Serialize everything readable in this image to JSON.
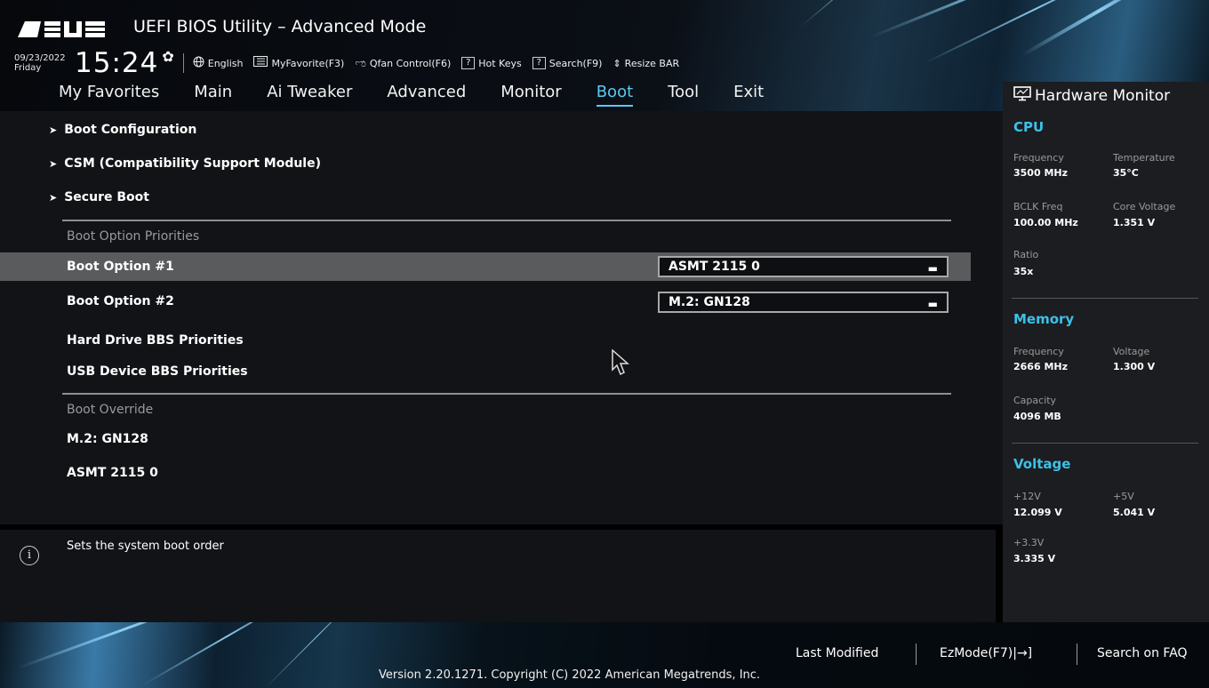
{
  "header": {
    "brand": "ASUS",
    "title": "UEFI BIOS Utility – Advanced Mode",
    "date": "09/23/2022",
    "day": "Friday",
    "time": "15:24",
    "items": [
      {
        "icon": "globe-icon",
        "label": "English"
      },
      {
        "icon": "favorite-icon",
        "label": "MyFavorite(F3)"
      },
      {
        "icon": "fan-icon",
        "label": "Qfan Control(F6)"
      },
      {
        "icon": "help-box-icon",
        "label": "Hot Keys"
      },
      {
        "icon": "help-box-icon",
        "label": "Search(F9)"
      },
      {
        "icon": "resize-bar-icon",
        "label": "Resize BAR"
      }
    ]
  },
  "nav": {
    "tabs": [
      "My Favorites",
      "Main",
      "Ai Tweaker",
      "Advanced",
      "Monitor",
      "Boot",
      "Tool",
      "Exit"
    ],
    "active": "Boot"
  },
  "main": {
    "submenus": [
      "Boot Configuration",
      "CSM (Compatibility Support Module)",
      "Secure Boot"
    ],
    "priorities_label": "Boot Option Priorities",
    "boot_option_1": {
      "label": "Boot Option #1",
      "value": "ASMT 2115 0"
    },
    "boot_option_2": {
      "label": "Boot Option #2",
      "value": "M.2: GN128"
    },
    "bbs": [
      "Hard Drive BBS Priorities",
      "USB Device BBS Priorities"
    ],
    "override_label": "Boot Override",
    "override_items": [
      "M.2: GN128",
      "ASMT 2115 0"
    ]
  },
  "help": {
    "text": "Sets the system boot order"
  },
  "hw_monitor": {
    "title": "Hardware Monitor",
    "cpu": {
      "label": "CPU",
      "freq_label": "Frequency",
      "freq": "3500 MHz",
      "temp_label": "Temperature",
      "temp": "35°C",
      "bclk_label": "BCLK Freq",
      "bclk": "100.00 MHz",
      "vcore_label": "Core Voltage",
      "vcore": "1.351 V",
      "ratio_label": "Ratio",
      "ratio": "35x"
    },
    "memory": {
      "label": "Memory",
      "freq_label": "Frequency",
      "freq": "2666 MHz",
      "volt_label": "Voltage",
      "volt": "1.300 V",
      "cap_label": "Capacity",
      "cap": "4096 MB"
    },
    "voltage": {
      "label": "Voltage",
      "v12_label": "+12V",
      "v12": "12.099 V",
      "v5_label": "+5V",
      "v5": "5.041 V",
      "v33_label": "+3.3V",
      "v33": "3.335 V"
    }
  },
  "footer": {
    "last_modified": "Last Modified",
    "ezmode": "EzMode(F7)|→]",
    "search_faq": "Search on FAQ",
    "version": "Version 2.20.1271. Copyright (C) 2022 American Megatrends, Inc."
  },
  "colors": {
    "accent": "#3ec0e8",
    "highlight_row": "#5a5b5d",
    "panel": "#111316",
    "sidebar": "#1b1d20"
  }
}
